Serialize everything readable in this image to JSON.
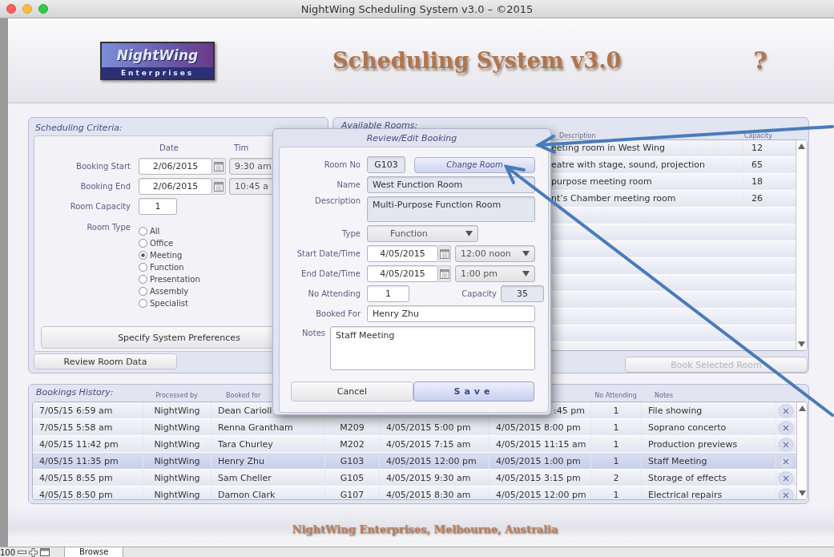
{
  "window": {
    "title": "NightWing Scheduling System v3.0 – ©2015"
  },
  "header": {
    "logo_top": "NightWing",
    "logo_bottom": "Enterprises",
    "title": "Scheduling System v3.0",
    "help": "?"
  },
  "criteria": {
    "title": "Scheduling Criteria:",
    "date_heading": "Date",
    "time_heading": "Tim",
    "fields": [
      {
        "label": "Booking Start",
        "date": "2/06/2015",
        "time": "9:30 am"
      },
      {
        "label": "Booking End",
        "date": "2/06/2015",
        "time": "10:45 a"
      }
    ],
    "capacity": {
      "label": "Room Capacity",
      "value": "1"
    },
    "room_type": {
      "label": "Room Type",
      "options": [
        {
          "label": "All",
          "selected": false
        },
        {
          "label": "Office",
          "selected": false
        },
        {
          "label": "Meeting",
          "selected": true
        },
        {
          "label": "Function",
          "selected": false
        },
        {
          "label": "Presentation",
          "selected": false
        },
        {
          "label": "Assembly",
          "selected": false
        },
        {
          "label": "Specialist",
          "selected": false
        }
      ]
    },
    "preferences_button": "Specify System Preferences",
    "review_button": "Review Room Data"
  },
  "rooms": {
    "title": "Available Rooms:",
    "columns": [
      "Description",
      "Capacity"
    ],
    "rows": [
      {
        "description": "eeting room in West Wing",
        "capacity": "12"
      },
      {
        "description": "eatre with stage, sound, projection",
        "capacity": "65"
      },
      {
        "description": "purpose meeting room",
        "capacity": "18"
      },
      {
        "description": "nt’s Chamber meeting room",
        "capacity": "26"
      }
    ],
    "book_button": {
      "label": "Book Selected Room",
      "disabled": true
    }
  },
  "history": {
    "title": "Bookings History:",
    "columns": {
      "processed_by": "Processed by",
      "booked_for": "Booked for",
      "no_attending": "No Attending",
      "notes": "Notes"
    },
    "rows": [
      {
        "made": "7/05/15 6:59 am",
        "processed_by": "NightWing",
        "booked_for": "Dean Carioll",
        "end": ":45 pm",
        "end_cut": true,
        "attending": "1",
        "notes": "File showing",
        "selected": false
      },
      {
        "made": "7/05/15 5:58 am",
        "processed_by": "NightWing",
        "booked_for": "Renna Grantham",
        "room": "M209",
        "start": "4/05/2015 5:00 pm",
        "end": "4/05/2015 8:00 pm",
        "attending": "1",
        "notes": "Soprano concerto",
        "selected": false
      },
      {
        "made": "4/05/15 11:42 pm",
        "processed_by": "NightWing",
        "booked_for": "Tara Churley",
        "room": "M202",
        "start": "4/05/2015 7:15 am",
        "end": "4/05/2015 11:15 am",
        "attending": "1",
        "notes": "Production previews",
        "selected": false
      },
      {
        "made": "4/05/15 11:35 pm",
        "processed_by": "NightWing",
        "booked_for": "Henry Zhu",
        "room": "G103",
        "start": "4/05/2015 12:00 pm",
        "end": "4/05/2015 1:00 pm",
        "attending": "1",
        "notes": "Staff Meeting",
        "selected": true
      },
      {
        "made": "4/05/15 8:55 pm",
        "processed_by": "NightWing",
        "booked_for": "Sam Cheller",
        "room": "G105",
        "start": "4/05/2015 9:30 am",
        "end": "4/05/2015 3:15 pm",
        "attending": "2",
        "notes": "Storage of effects",
        "selected": false
      },
      {
        "made": "4/05/15 8:50 pm",
        "processed_by": "NightWing",
        "booked_for": "Damon Clark",
        "room": "G107",
        "start": "4/05/2015 8:30 am",
        "end": "4/05/2015 12:00 pm",
        "attending": "1",
        "notes": "Electrical repairs",
        "selected": false
      }
    ]
  },
  "dialog": {
    "title": "Review/Edit Booking",
    "room_no": {
      "label": "Room No",
      "value": "G103"
    },
    "change_room": "Change Room",
    "name": {
      "label": "Name",
      "value": "West Function Room"
    },
    "description": {
      "label": "Description",
      "value": "Multi-Purpose Function Room"
    },
    "type": {
      "label": "Type",
      "value": "Function"
    },
    "start": {
      "label": "Start Date/Time",
      "date": "4/05/2015",
      "time": "12:00 noon"
    },
    "end": {
      "label": "End Date/Time",
      "date": "4/05/2015",
      "time": "1:00 pm"
    },
    "attending": {
      "label": "No Attending",
      "value": "1"
    },
    "capacity": {
      "label": "Capacity",
      "value": "35"
    },
    "booked_for": {
      "label": "Booked For",
      "value": "Henry Zhu"
    },
    "notes": {
      "label": "Notes",
      "value": "Staff Meeting"
    },
    "buttons": [
      {
        "label": "Cancel",
        "kind": "plain"
      },
      {
        "label": "Save",
        "kind": "primary"
      }
    ]
  },
  "footer": "NightWing Enterprises, Melbourne, Australia",
  "status_bar": {
    "zoom": "100",
    "mode": "Browse"
  }
}
